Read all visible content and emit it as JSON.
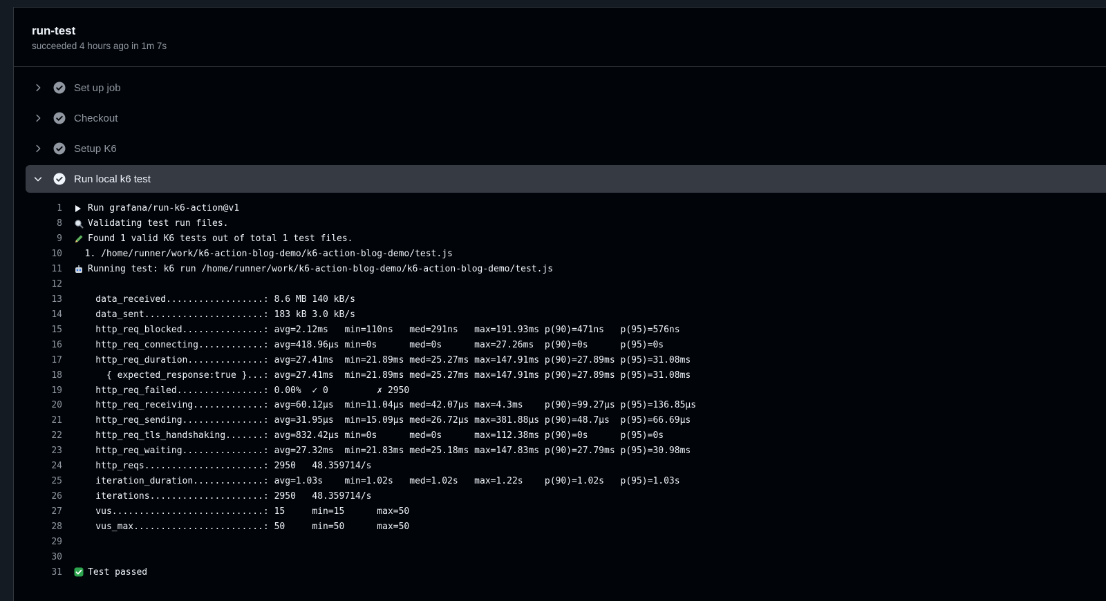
{
  "job": {
    "title": "run-test",
    "subtitle": "succeeded 4 hours ago in 1m 7s"
  },
  "steps": [
    {
      "label": "Set up job",
      "status_icon": "check-circle-icon",
      "expanded": false
    },
    {
      "label": "Checkout",
      "status_icon": "check-circle-icon",
      "expanded": false
    },
    {
      "label": "Setup K6",
      "status_icon": "check-circle-icon",
      "expanded": false
    },
    {
      "label": "Run local k6 test",
      "status_icon": "check-circle-icon",
      "expanded": true
    }
  ],
  "log": [
    {
      "n": "1",
      "icon": "triangle-right-icon",
      "text": "Run grafana/run-k6-action@v1"
    },
    {
      "n": "8",
      "icon": "magnifier-icon",
      "text": "Validating test run files."
    },
    {
      "n": "9",
      "icon": "pencil-icon",
      "text": "Found 1 valid K6 tests out of total 1 test files."
    },
    {
      "n": "10",
      "icon": "",
      "text": "  1. /home/runner/work/k6-action-blog-demo/k6-action-blog-demo/test.js"
    },
    {
      "n": "11",
      "icon": "robot-icon",
      "text": "Running test: k6 run /home/runner/work/k6-action-blog-demo/k6-action-blog-demo/test.js"
    },
    {
      "n": "12",
      "icon": "",
      "text": ""
    },
    {
      "n": "13",
      "icon": "",
      "text": "    data_received..................: 8.6 MB 140 kB/s"
    },
    {
      "n": "14",
      "icon": "",
      "text": "    data_sent......................: 183 kB 3.0 kB/s"
    },
    {
      "n": "15",
      "icon": "",
      "text": "    http_req_blocked...............: avg=2.12ms   min=110ns   med=291ns   max=191.93ms p(90)=471ns   p(95)=576ns"
    },
    {
      "n": "16",
      "icon": "",
      "text": "    http_req_connecting............: avg=418.96µs min=0s      med=0s      max=27.26ms  p(90)=0s      p(95)=0s"
    },
    {
      "n": "17",
      "icon": "",
      "text": "    http_req_duration..............: avg=27.41ms  min=21.89ms med=25.27ms max=147.91ms p(90)=27.89ms p(95)=31.08ms"
    },
    {
      "n": "18",
      "icon": "",
      "text": "      { expected_response:true }...: avg=27.41ms  min=21.89ms med=25.27ms max=147.91ms p(90)=27.89ms p(95)=31.08ms"
    },
    {
      "n": "19",
      "icon": "",
      "text": "    http_req_failed................: 0.00%  ✓ 0         ✗ 2950"
    },
    {
      "n": "20",
      "icon": "",
      "text": "    http_req_receiving.............: avg=60.12µs  min=11.04µs med=42.07µs max=4.3ms    p(90)=99.27µs p(95)=136.85µs"
    },
    {
      "n": "21",
      "icon": "",
      "text": "    http_req_sending...............: avg=31.95µs  min=15.09µs med=26.72µs max=381.88µs p(90)=48.7µs  p(95)=66.69µs"
    },
    {
      "n": "22",
      "icon": "",
      "text": "    http_req_tls_handshaking.......: avg=832.42µs min=0s      med=0s      max=112.38ms p(90)=0s      p(95)=0s"
    },
    {
      "n": "23",
      "icon": "",
      "text": "    http_req_waiting...............: avg=27.32ms  min=21.83ms med=25.18ms max=147.83ms p(90)=27.79ms p(95)=30.98ms"
    },
    {
      "n": "24",
      "icon": "",
      "text": "    http_reqs......................: 2950   48.359714/s"
    },
    {
      "n": "25",
      "icon": "",
      "text": "    iteration_duration.............: avg=1.03s    min=1.02s   med=1.02s   max=1.22s    p(90)=1.02s   p(95)=1.03s"
    },
    {
      "n": "26",
      "icon": "",
      "text": "    iterations.....................: 2950   48.359714/s"
    },
    {
      "n": "27",
      "icon": "",
      "text": "    vus............................: 15     min=15      max=50"
    },
    {
      "n": "28",
      "icon": "",
      "text": "    vus_max........................: 50     min=50      max=50"
    },
    {
      "n": "29",
      "icon": "",
      "text": ""
    },
    {
      "n": "30",
      "icon": "",
      "text": ""
    },
    {
      "n": "31",
      "icon": "check-mark-button-icon",
      "text": "Test passed"
    }
  ],
  "colors": {
    "background": "#010409",
    "panel": "#151b23",
    "expanded_step": "#363b43",
    "text": "#f0f6fc",
    "muted": "#9198a1",
    "pass_green": "#2da44e"
  }
}
